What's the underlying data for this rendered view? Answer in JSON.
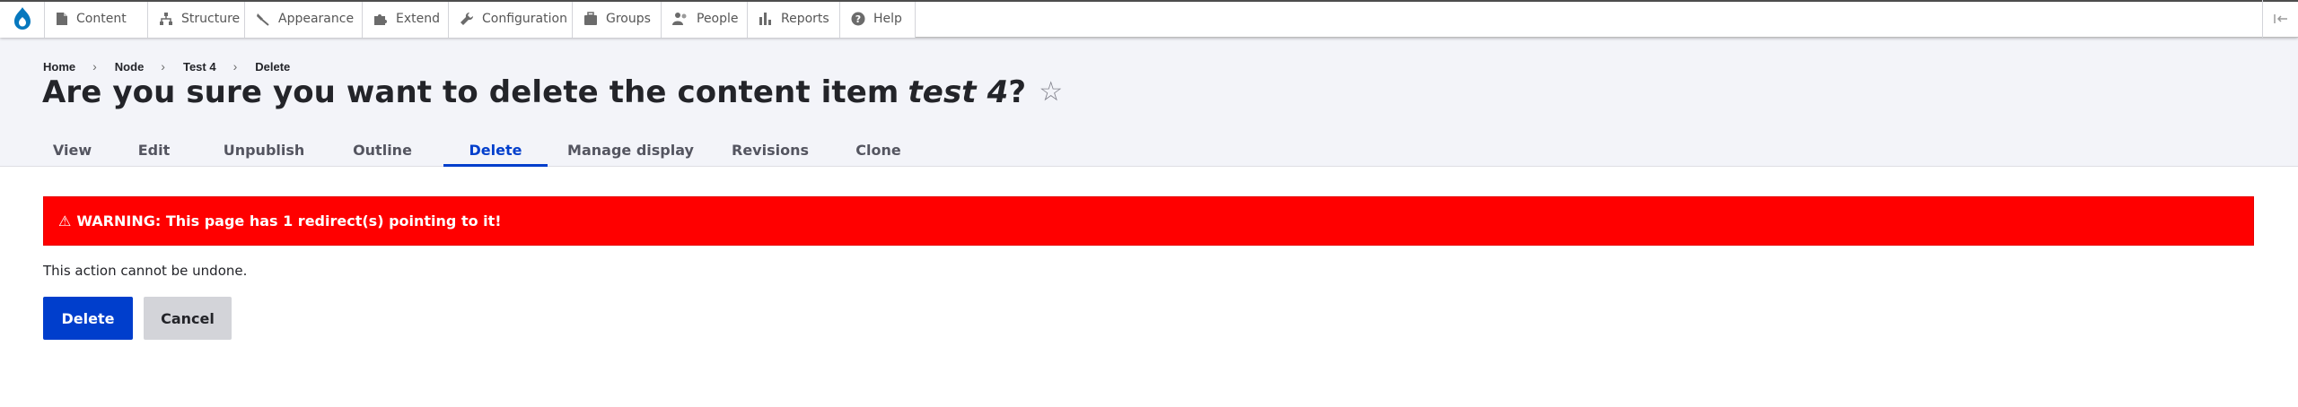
{
  "toolbar": {
    "items": [
      {
        "label": "Content",
        "icon": "file-icon"
      },
      {
        "label": "Structure",
        "icon": "sitemap-icon"
      },
      {
        "label": "Appearance",
        "icon": "paint-roller-icon"
      },
      {
        "label": "Extend",
        "icon": "puzzle-icon"
      },
      {
        "label": "Configuration",
        "icon": "wrench-icon"
      },
      {
        "label": "Groups",
        "icon": "briefcase-icon"
      },
      {
        "label": "People",
        "icon": "people-icon"
      },
      {
        "label": "Reports",
        "icon": "bar-chart-icon"
      },
      {
        "label": "Help",
        "icon": "help-icon"
      }
    ]
  },
  "breadcrumb": [
    "Home",
    "Node",
    "Test 4",
    "Delete"
  ],
  "title": {
    "prefix": "Are you sure you want to delete the content item",
    "item": "test 4",
    "suffix": "?",
    "star": "☆"
  },
  "tabs": [
    "View",
    "Edit",
    "Unpublish",
    "Outline",
    "Delete",
    "Manage display",
    "Revisions",
    "Clone"
  ],
  "active_tab": "Delete",
  "warning": {
    "glyph": "⚠",
    "text": "WARNING: This page has 1 redirect(s) pointing to it!"
  },
  "description": "This action cannot be undone.",
  "buttons": {
    "delete": "Delete",
    "cancel": "Cancel"
  },
  "colors": {
    "accent": "#003ecc",
    "warning_bg": "#ff0000",
    "header_bg": "#f3f4f9",
    "drupal_blue": "#0678be"
  }
}
